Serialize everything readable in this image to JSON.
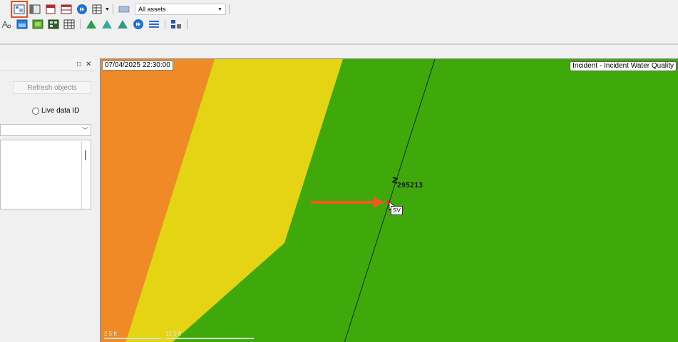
{
  "toolbar": {
    "row1": {
      "asset_filter": {
        "selected": "All assets"
      }
    }
  },
  "left_panel": {
    "refresh_button": "Refresh objects",
    "live_data_label": "Live data ID"
  },
  "map": {
    "timestamp": "07/04/2025 22:30:00",
    "layer_label": "Incident - Incident Water Quality",
    "asset_label": "295213",
    "cursor_tooltip": "SV",
    "scale_left": "2.5 ft",
    "scale_right": "12.5 ft",
    "zone_colors": {
      "orange": "#ef8a26",
      "yellow": "#e5d414",
      "green": "#3fa80b"
    },
    "pointer_arrow_color": "#ee5a1f"
  }
}
